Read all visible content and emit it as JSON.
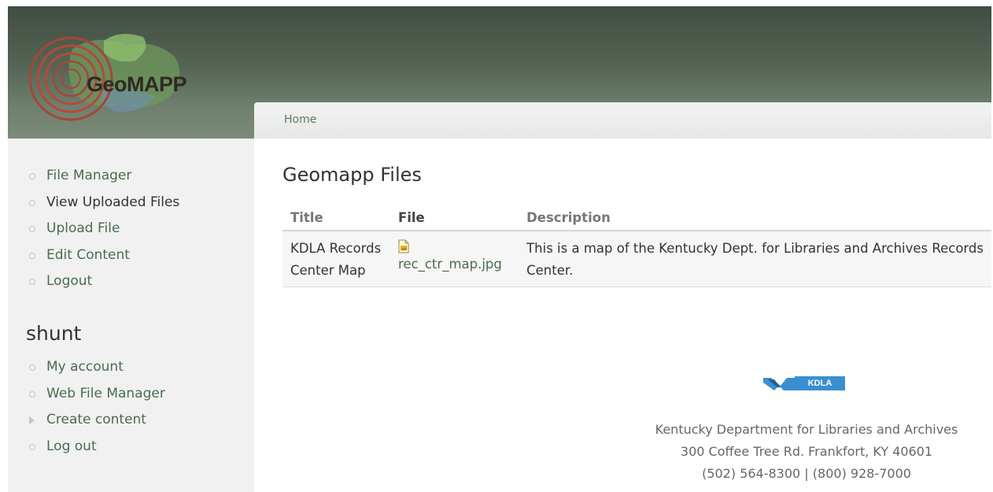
{
  "header": {
    "logo_text": "GeoMAPP",
    "breadcrumb": "Home"
  },
  "sidebar": {
    "menu": [
      {
        "label": "File Manager"
      },
      {
        "label": "View Uploaded Files"
      },
      {
        "label": "Upload File"
      },
      {
        "label": "Edit Content"
      },
      {
        "label": "Logout"
      }
    ],
    "user_heading": "shunt",
    "user_menu": [
      {
        "label": "My account"
      },
      {
        "label": "Web File Manager"
      },
      {
        "label": "Create content"
      },
      {
        "label": "Log out"
      }
    ]
  },
  "main": {
    "title": "Geomapp Files",
    "table": {
      "headers": [
        "Title",
        "File",
        "Description"
      ],
      "rows": [
        {
          "title": "KDLA Records Center Map",
          "file": "rec_ctr_map.jpg",
          "description_line1": "This is a map of the Kentucky Dept. for Libraries and Archives Records",
          "description_line2": "Center."
        }
      ]
    }
  },
  "footer": {
    "logo_text": "KDLA",
    "org": "Kentucky Department for Libraries and Archives",
    "address": "300 Coffee Tree Rd. Frankfort, KY 40601",
    "phones": "(502) 564-8300 | (800) 928-7000"
  },
  "colors": {
    "header_dark": "#414d42",
    "header_light": "#7b8b79",
    "link": "#4b6b4e",
    "sidebar_bg": "#f0f1f0",
    "kdla_blue": "#3a8fd0"
  }
}
